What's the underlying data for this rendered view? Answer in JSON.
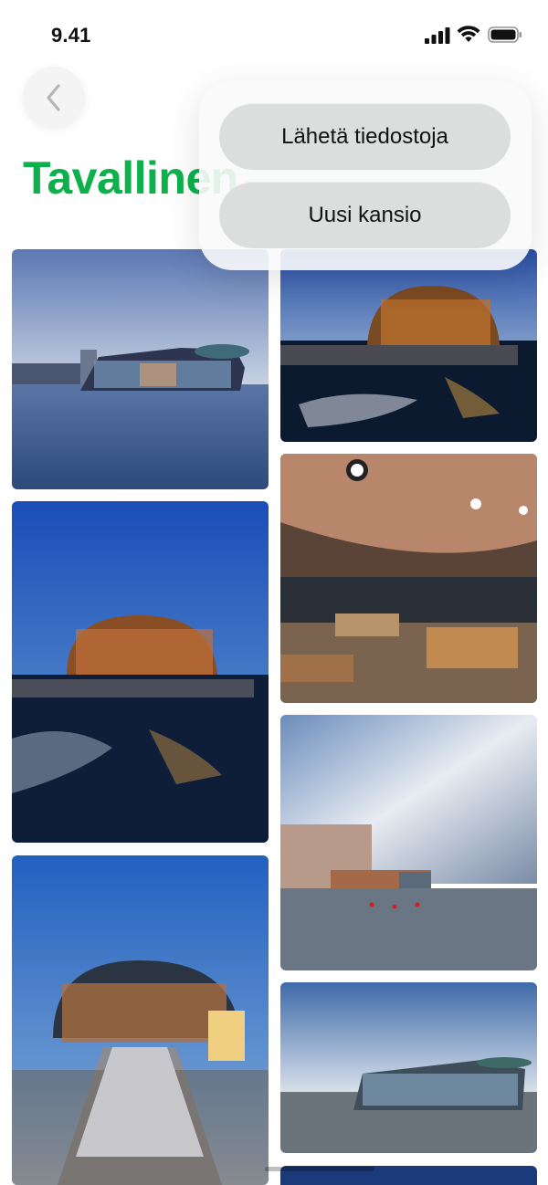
{
  "status_bar": {
    "time": "9.41"
  },
  "header": {
    "title": "Tavallinen"
  },
  "menu": {
    "items": [
      {
        "label": "Lähetä tiedostoja"
      },
      {
        "label": "Uusi kansio"
      }
    ]
  },
  "icons": {
    "back": "chevron-left-icon",
    "signal": "cellular-signal-icon",
    "wifi": "wifi-icon",
    "battery": "battery-icon"
  },
  "colors": {
    "title_green": "#0cb14b"
  }
}
